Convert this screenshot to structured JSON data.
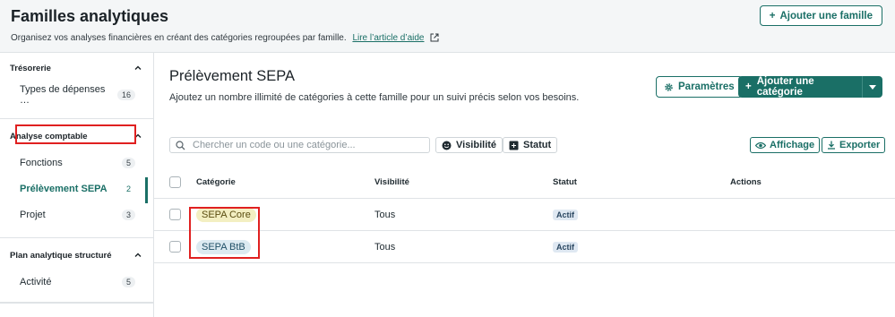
{
  "header": {
    "title": "Familles analytiques",
    "subtitle": "Organisez vos analyses financières en créant des catégories regroupées par famille.",
    "help_link": "Lire l’article d’aide",
    "add_family_label": "Ajouter une famille"
  },
  "sidebar": {
    "groups": [
      {
        "title": "Trésorerie",
        "items": [
          {
            "label": "Types de dépenses …",
            "count": "16"
          }
        ]
      },
      {
        "title": "Analyse comptable",
        "items": [
          {
            "label": "Fonctions",
            "count": "5"
          },
          {
            "label": "Prélèvement SEPA",
            "count": "2"
          },
          {
            "label": "Projet",
            "count": "3"
          }
        ]
      },
      {
        "title": "Plan analytique structuré",
        "items": [
          {
            "label": "Activité",
            "count": "5"
          }
        ]
      }
    ]
  },
  "main": {
    "title": "Prélèvement SEPA",
    "subtitle": "Ajoutez un nombre illimité de catégories à cette famille pour un suivi précis selon vos besoins.",
    "params_label": "Paramètres",
    "add_category_label": "Ajouter une catégorie",
    "search_placeholder": "Chercher un code ou une catégorie...",
    "filter_visibility": "Visibilité",
    "filter_status": "Statut",
    "display_label": "Affichage",
    "export_label": "Exporter",
    "table": {
      "columns": [
        "Catégorie",
        "Visibilité",
        "Statut",
        "Actions"
      ],
      "rows": [
        {
          "category": "SEPA Core",
          "visibility": "Tous",
          "status": "Actif"
        },
        {
          "category": "SEPA BtB",
          "visibility": "Tous",
          "status": "Actif"
        }
      ]
    }
  },
  "colors": {
    "accent": "#1a6f66",
    "highlight": "#e02020"
  }
}
